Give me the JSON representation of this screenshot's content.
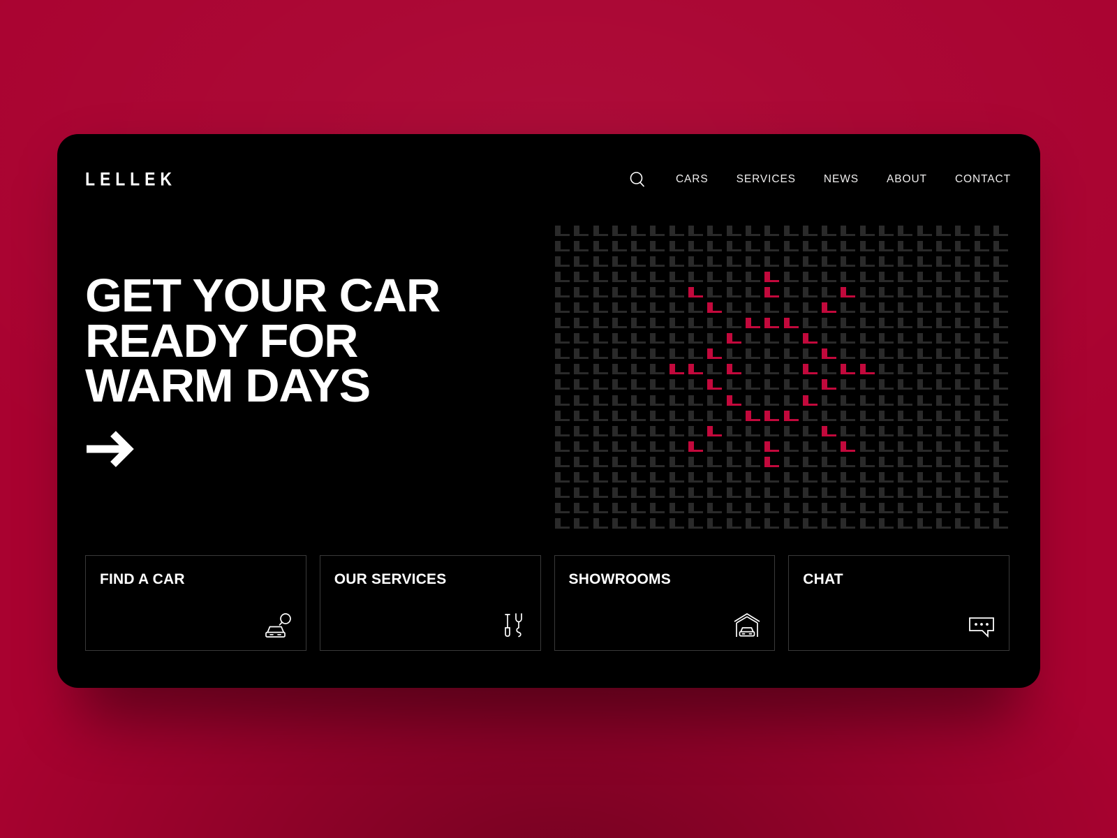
{
  "theme": {
    "background_crimson": "#a90230",
    "panel_black": "#000000",
    "accent_red": "#c2093c",
    "pattern_dark": "#2a2a2a",
    "text_white": "#ffffff",
    "card_border": "#3a3a3a"
  },
  "header": {
    "logo": "LELLEK",
    "search_icon": "search-icon",
    "nav": [
      {
        "label": "CARS"
      },
      {
        "label": "SERVICES"
      },
      {
        "label": "NEWS"
      },
      {
        "label": "ABOUT"
      },
      {
        "label": "CONTACT"
      }
    ]
  },
  "hero": {
    "headline_lines": [
      "GET YOUR CAR",
      "READY FOR",
      "WARM DAYS"
    ],
    "cta_icon": "arrow-right-icon"
  },
  "pattern": {
    "glyph": "L",
    "columns": 24,
    "rows": 20,
    "dark_color": "#2a2a2a",
    "accent_color": "#c2093c",
    "accent_cells": [
      [
        3,
        11
      ],
      [
        4,
        7
      ],
      [
        4,
        11
      ],
      [
        4,
        15
      ],
      [
        5,
        8
      ],
      [
        5,
        14
      ],
      [
        6,
        10
      ],
      [
        6,
        11
      ],
      [
        6,
        12
      ],
      [
        7,
        9
      ],
      [
        7,
        13
      ],
      [
        8,
        8
      ],
      [
        8,
        14
      ],
      [
        9,
        6
      ],
      [
        9,
        7
      ],
      [
        9,
        9
      ],
      [
        9,
        13
      ],
      [
        9,
        15
      ],
      [
        9,
        16
      ],
      [
        10,
        8
      ],
      [
        10,
        14
      ],
      [
        11,
        9
      ],
      [
        11,
        13
      ],
      [
        12,
        10
      ],
      [
        12,
        11
      ],
      [
        12,
        12
      ],
      [
        13,
        8
      ],
      [
        13,
        14
      ],
      [
        14,
        7
      ],
      [
        14,
        11
      ],
      [
        14,
        15
      ],
      [
        15,
        11
      ]
    ]
  },
  "cards": [
    {
      "title": "FIND A CAR",
      "icon": "car-search-icon"
    },
    {
      "title": "OUR SERVICES",
      "icon": "tools-icon"
    },
    {
      "title": "SHOWROOMS",
      "icon": "garage-car-icon"
    },
    {
      "title": "CHAT",
      "icon": "chat-bubble-icon"
    }
  ]
}
